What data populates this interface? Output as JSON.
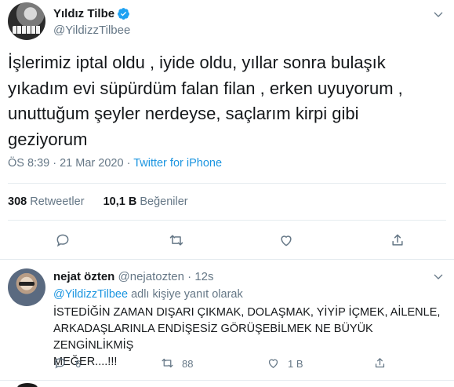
{
  "tweet": {
    "author_name": "Yıldız Tilbe",
    "author_handle": "@YildizzTilbee",
    "text": "İşlerimiz iptal oldu , iyide oldu, yıllar sonra bulaşık\nyıkadım evi süpürdüm falan filan , erken uyuyorum ,\nunuttuğum şeyler nerdeyse, saçlarım kirpi gibi\ngeziyorum",
    "time": "ÖS 8:39",
    "separator": "·",
    "date": "21 Mar 2020",
    "source": "Twitter for iPhone",
    "retweet_count": "308",
    "retweet_label": "Retweetler",
    "like_count": "10,1 B",
    "like_label": "Beğeniler"
  },
  "reply": {
    "author_name": "nejat özten",
    "author_handle": "@nejatozten",
    "dot": "·",
    "time": "12s",
    "replying_mention": "@YildizzTilbee",
    "replying_suffix": " adlı kişiye yanıt olarak",
    "text": "İSTEDİĞİN ZAMAN DIŞARI ÇIKMAK, DOLAŞMAK, YİYİP İÇMEK, AİLENLE,\nARKADAŞLARINLA ENDİŞESİZ GÖRÜŞEBİLMEK NE BÜYÜK ZENGİNLİKMİŞ\nMEĞER....!!!",
    "reply_count": "6",
    "retweet_count": "88",
    "like_count": "1 B"
  },
  "colors": {
    "accent": "#1b95e0",
    "muted": "#657786",
    "text": "#14171a",
    "divider": "#e6ecf0"
  },
  "icons": [
    "verified-icon",
    "chevron-down-icon",
    "reply-icon",
    "retweet-icon",
    "like-icon",
    "share-icon"
  ]
}
